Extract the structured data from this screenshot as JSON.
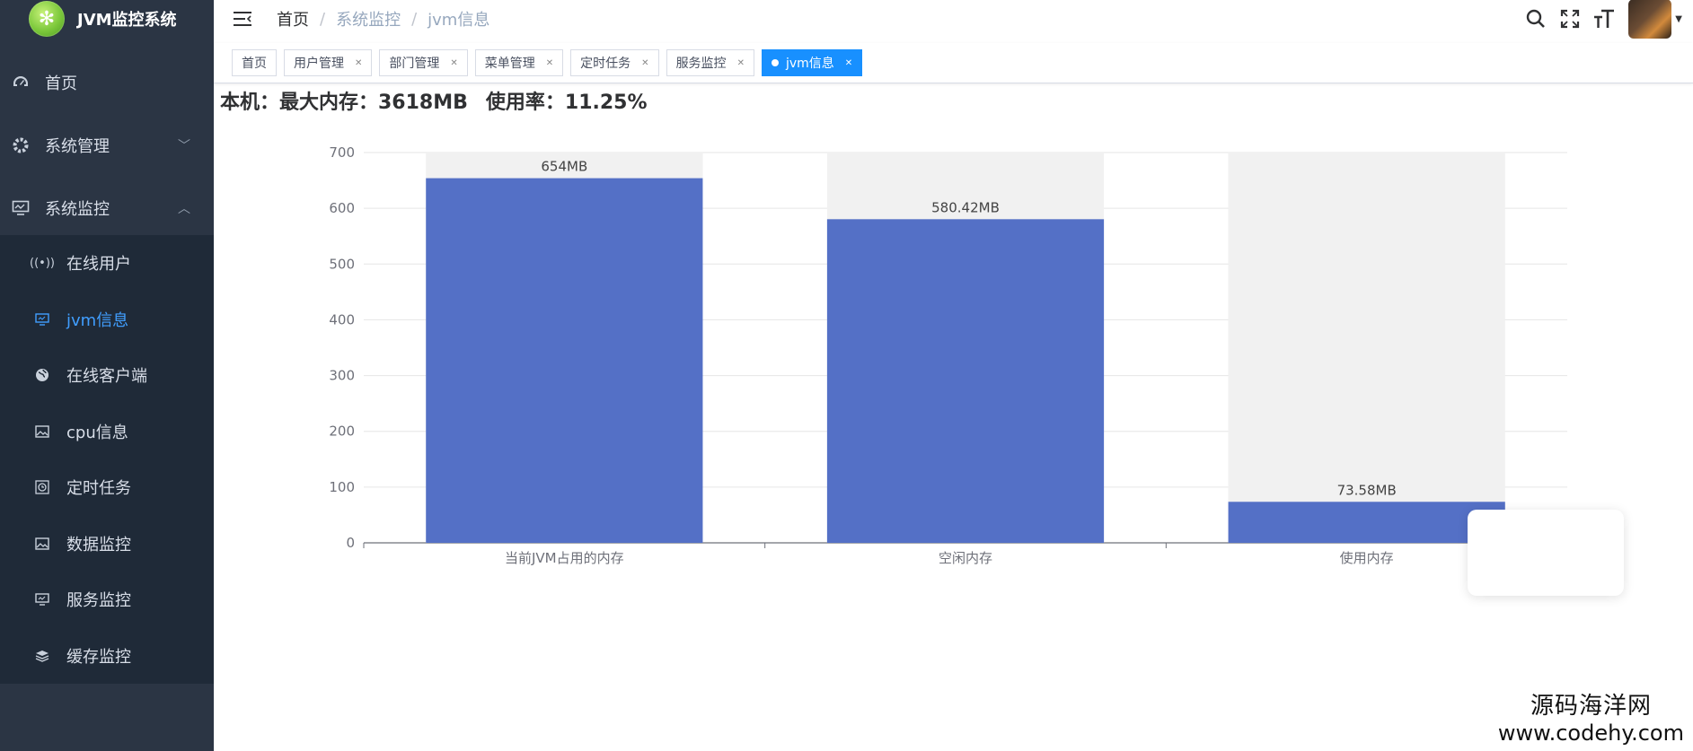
{
  "app": {
    "title": "JVM监控系统"
  },
  "sidebar": {
    "top_items": [
      {
        "label": "首页",
        "icon": "dashboard-icon"
      },
      {
        "label": "系统管理",
        "icon": "gear-icon"
      },
      {
        "label": "系统监控",
        "icon": "monitor-icon"
      }
    ],
    "sub_items": [
      {
        "label": "在线用户",
        "icon": "signal-icon"
      },
      {
        "label": "jvm信息",
        "icon": "screen-icon",
        "active": true
      },
      {
        "label": "在线客户端",
        "icon": "globe-icon"
      },
      {
        "label": "cpu信息",
        "icon": "image-icon"
      },
      {
        "label": "定时任务",
        "icon": "timer-icon"
      },
      {
        "label": "数据监控",
        "icon": "image-icon"
      },
      {
        "label": "服务监控",
        "icon": "screen-icon"
      },
      {
        "label": "缓存监控",
        "icon": "layers-icon"
      }
    ]
  },
  "breadcrumb": [
    "首页",
    "系统监控",
    "jvm信息"
  ],
  "tags": [
    {
      "label": "首页",
      "closable": false
    },
    {
      "label": "用户管理",
      "closable": true
    },
    {
      "label": "部门管理",
      "closable": true
    },
    {
      "label": "菜单管理",
      "closable": true
    },
    {
      "label": "定时任务",
      "closable": true
    },
    {
      "label": "服务监控",
      "closable": true
    },
    {
      "label": "jvm信息",
      "closable": true,
      "active": true
    }
  ],
  "summary": {
    "max_memory": "本机：最大内存：3618MB",
    "usage_rate": "使用率：11.25%"
  },
  "colors": {
    "sidebar_bg": "#2b3544",
    "submenu_bg": "#1f2a38",
    "active_blue": "#1890ff",
    "bar": "#5470c6",
    "bar_bg": "#f1f1f1"
  },
  "chart_data": {
    "type": "bar",
    "categories": [
      "当前JVM占用的内存",
      "空闲内存",
      "使用内存"
    ],
    "values": [
      654,
      580.42,
      73.58
    ],
    "data_labels": [
      "654MB",
      "580.42MB",
      "73.58MB"
    ],
    "background_max": 700,
    "ylim": [
      0,
      700
    ],
    "yticks": [
      0,
      100,
      200,
      300,
      400,
      500,
      600,
      700
    ],
    "grid": true
  },
  "watermark": {
    "line1": "源码海洋网",
    "line2": "www.codehy.com"
  }
}
